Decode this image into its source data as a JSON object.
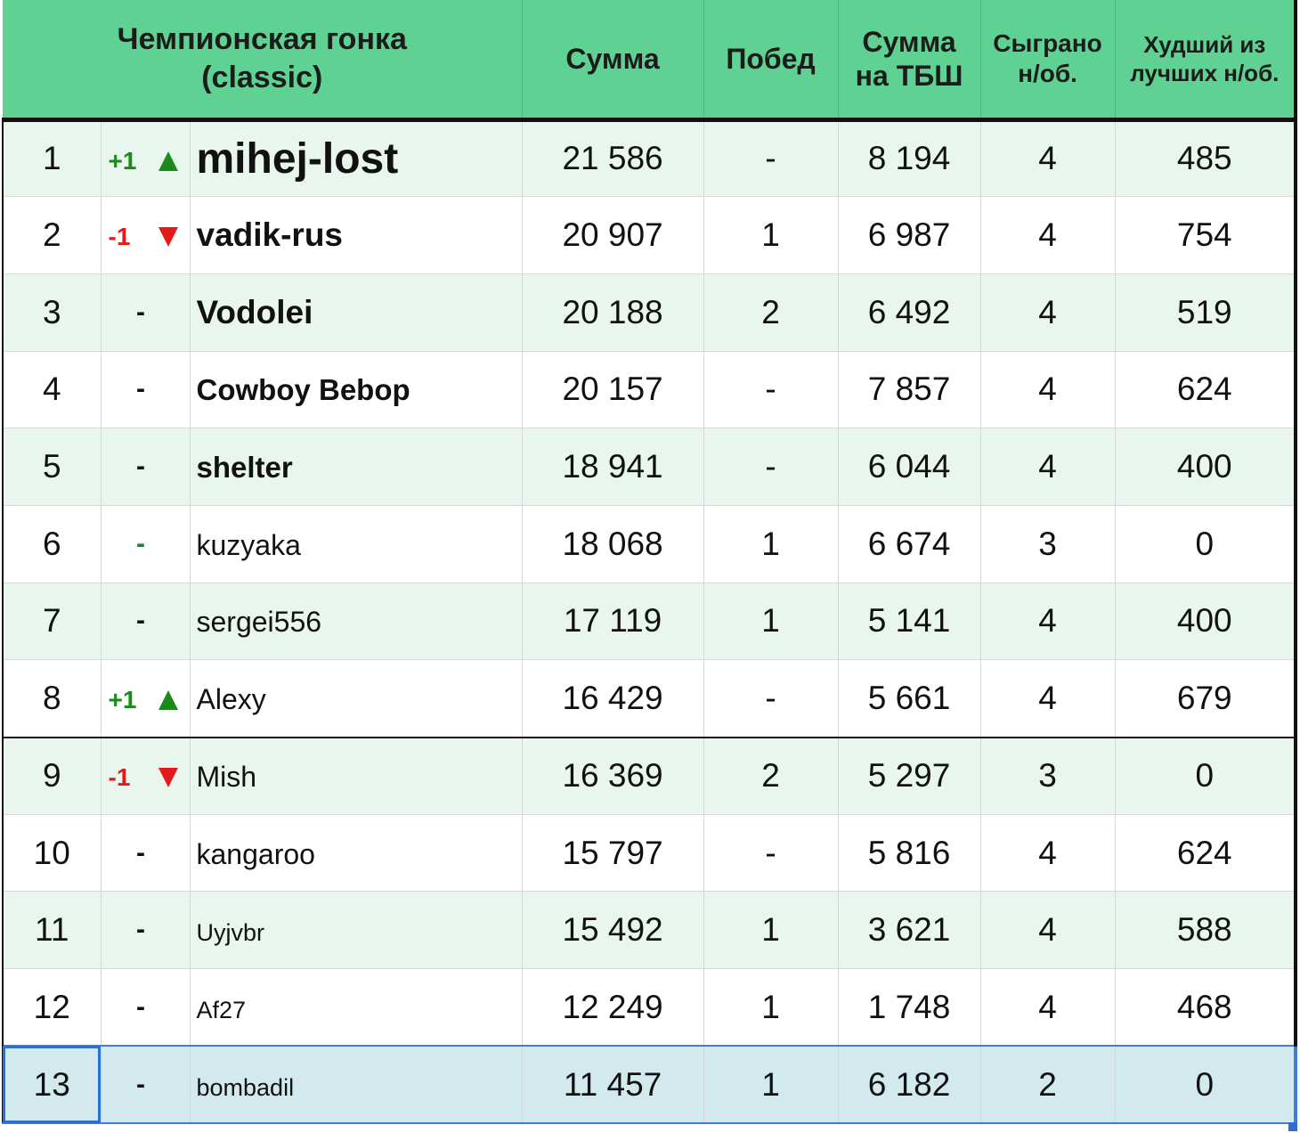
{
  "header": {
    "title_line1": "Чемпионская гонка",
    "title_line2": "(classic)",
    "sum": "Сумма",
    "wins": "Побед",
    "tbsh_line1": "Сумма",
    "tbsh_line2": "на ТБШ",
    "played_line1": "Сыграно",
    "played_line2": "н/об.",
    "worst_line1": "Худший из",
    "worst_line2": "лучших н/об."
  },
  "colors": {
    "header_bg": "#5fd293",
    "row_alt_bg": "#e8f6ee",
    "selected_bg": "#d2e9ee",
    "up": "#1a8a1a",
    "down": "#e31a1a",
    "selection": "#2d6fd0"
  },
  "rows": [
    {
      "rank": "1",
      "move": "+1",
      "dir": "up",
      "name": "mihej-lost",
      "sum": "21 586",
      "wins": "-",
      "tbsh": "8 194",
      "played": "4",
      "worst": "485"
    },
    {
      "rank": "2",
      "move": "-1",
      "dir": "down",
      "name": "vadik-rus",
      "sum": "20 907",
      "wins": "1",
      "tbsh": "6 987",
      "played": "4",
      "worst": "754"
    },
    {
      "rank": "3",
      "move": "-",
      "dir": "none",
      "name": "Vodolei",
      "sum": "20 188",
      "wins": "2",
      "tbsh": "6 492",
      "played": "4",
      "worst": "519"
    },
    {
      "rank": "4",
      "move": "-",
      "dir": "none",
      "name": "Cowboy Bebop",
      "sum": "20 157",
      "wins": "-",
      "tbsh": "7 857",
      "played": "4",
      "worst": "624"
    },
    {
      "rank": "5",
      "move": "-",
      "dir": "none",
      "name": "shelter",
      "sum": "18 941",
      "wins": "-",
      "tbsh": "6 044",
      "played": "4",
      "worst": "400"
    },
    {
      "rank": "6",
      "move": "-",
      "dir": "none-green",
      "name": "kuzyaka",
      "sum": "18 068",
      "wins": "1",
      "tbsh": "6 674",
      "played": "3",
      "worst": "0"
    },
    {
      "rank": "7",
      "move": "-",
      "dir": "none",
      "name": "sergei556",
      "sum": "17 119",
      "wins": "1",
      "tbsh": "5 141",
      "played": "4",
      "worst": "400"
    },
    {
      "rank": "8",
      "move": "+1",
      "dir": "up",
      "name": "Alexy",
      "sum": "16 429",
      "wins": "-",
      "tbsh": "5 661",
      "played": "4",
      "worst": "679"
    },
    {
      "rank": "9",
      "move": "-1",
      "dir": "down",
      "name": "Mish",
      "sum": "16 369",
      "wins": "2",
      "tbsh": "5 297",
      "played": "3",
      "worst": "0"
    },
    {
      "rank": "10",
      "move": "-",
      "dir": "none",
      "name": "kangaroo",
      "sum": "15 797",
      "wins": "-",
      "tbsh": "5 816",
      "played": "4",
      "worst": "624"
    },
    {
      "rank": "11",
      "move": "-",
      "dir": "none",
      "name": "Uyjvbr",
      "sum": "15 492",
      "wins": "1",
      "tbsh": "3 621",
      "played": "4",
      "worst": "588"
    },
    {
      "rank": "12",
      "move": "-",
      "dir": "none",
      "name": "Af27",
      "sum": "12 249",
      "wins": "1",
      "tbsh": "1 748",
      "played": "4",
      "worst": "468"
    },
    {
      "rank": "13",
      "move": "-",
      "dir": "none",
      "name": "bombadil",
      "sum": "11 457",
      "wins": "1",
      "tbsh": "6 182",
      "played": "2",
      "worst": "0"
    }
  ]
}
